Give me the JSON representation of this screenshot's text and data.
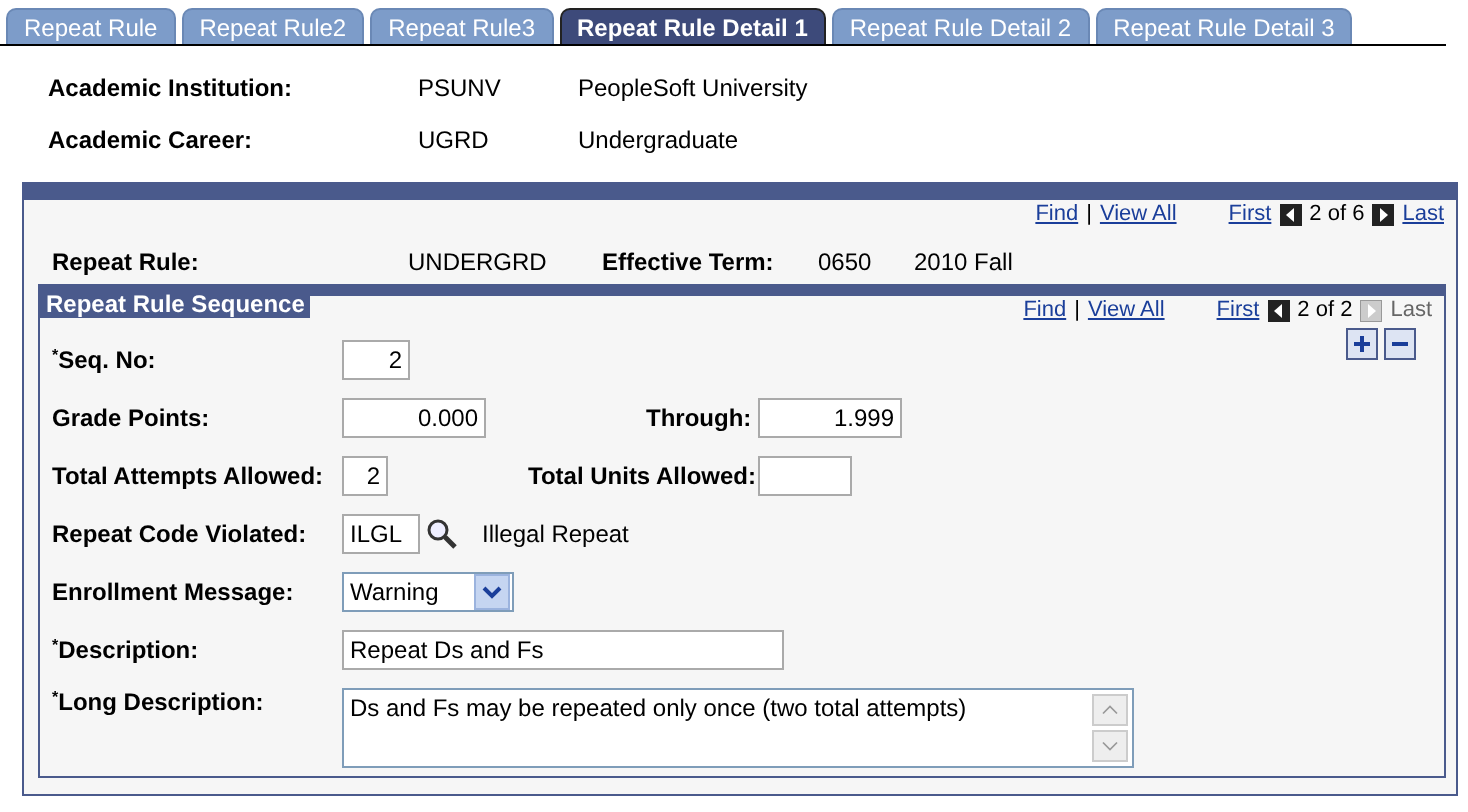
{
  "tabs": [
    {
      "label": "Repeat Rule",
      "selected": false
    },
    {
      "label": "Repeat Rule2",
      "selected": false
    },
    {
      "label": "Repeat Rule3",
      "selected": false
    },
    {
      "label": "Repeat Rule Detail 1",
      "selected": true
    },
    {
      "label": "Repeat Rule Detail 2",
      "selected": false
    },
    {
      "label": "Repeat Rule Detail 3",
      "selected": false
    }
  ],
  "header_fields": [
    {
      "label": "Academic Institution:",
      "code": "PSUNV",
      "description": "PeopleSoft University"
    },
    {
      "label": "Academic Career:",
      "code": "UGRD",
      "description": "Undergraduate"
    }
  ],
  "outer_nav": {
    "find": "Find",
    "separator": "|",
    "view_all": "View All",
    "first": "First",
    "count": "2 of 6",
    "last": "Last",
    "prev_disabled": false,
    "next_disabled": false
  },
  "repeat_rule": {
    "label": "Repeat Rule:",
    "value": "UNDERGRD",
    "term_label": "Effective Term:",
    "term_code": "0650",
    "term_description": "2010 Fall"
  },
  "sequence": {
    "title": "Repeat Rule Sequence",
    "nav": {
      "find": "Find",
      "separator": "|",
      "view_all": "View All",
      "first": "First",
      "count": "2 of 2",
      "last": "Last",
      "prev_disabled": false,
      "next_disabled": true
    },
    "seq_no": {
      "label": "Seq. No:",
      "required_mark": "*",
      "value": "2"
    },
    "grade_points": {
      "label": "Grade Points:",
      "value": "0.000"
    },
    "through": {
      "label": "Through:",
      "value": "1.999"
    },
    "total_attempts": {
      "label": "Total Attempts Allowed:",
      "value": "2"
    },
    "total_units": {
      "label": "Total Units Allowed:"
    },
    "repeat_code": {
      "label": "Repeat Code Violated:",
      "value": "ILGL",
      "description": "Illegal Repeat"
    },
    "enrollment_message": {
      "label": "Enrollment Message:",
      "value": "Warning"
    },
    "description": {
      "label": "Description:",
      "required_mark": "*",
      "value": "Repeat Ds and Fs"
    },
    "long_description": {
      "label": "Long Description:",
      "required_mark": "*",
      "value": "Ds and Fs may be repeated only once (two total attempts)"
    }
  }
}
